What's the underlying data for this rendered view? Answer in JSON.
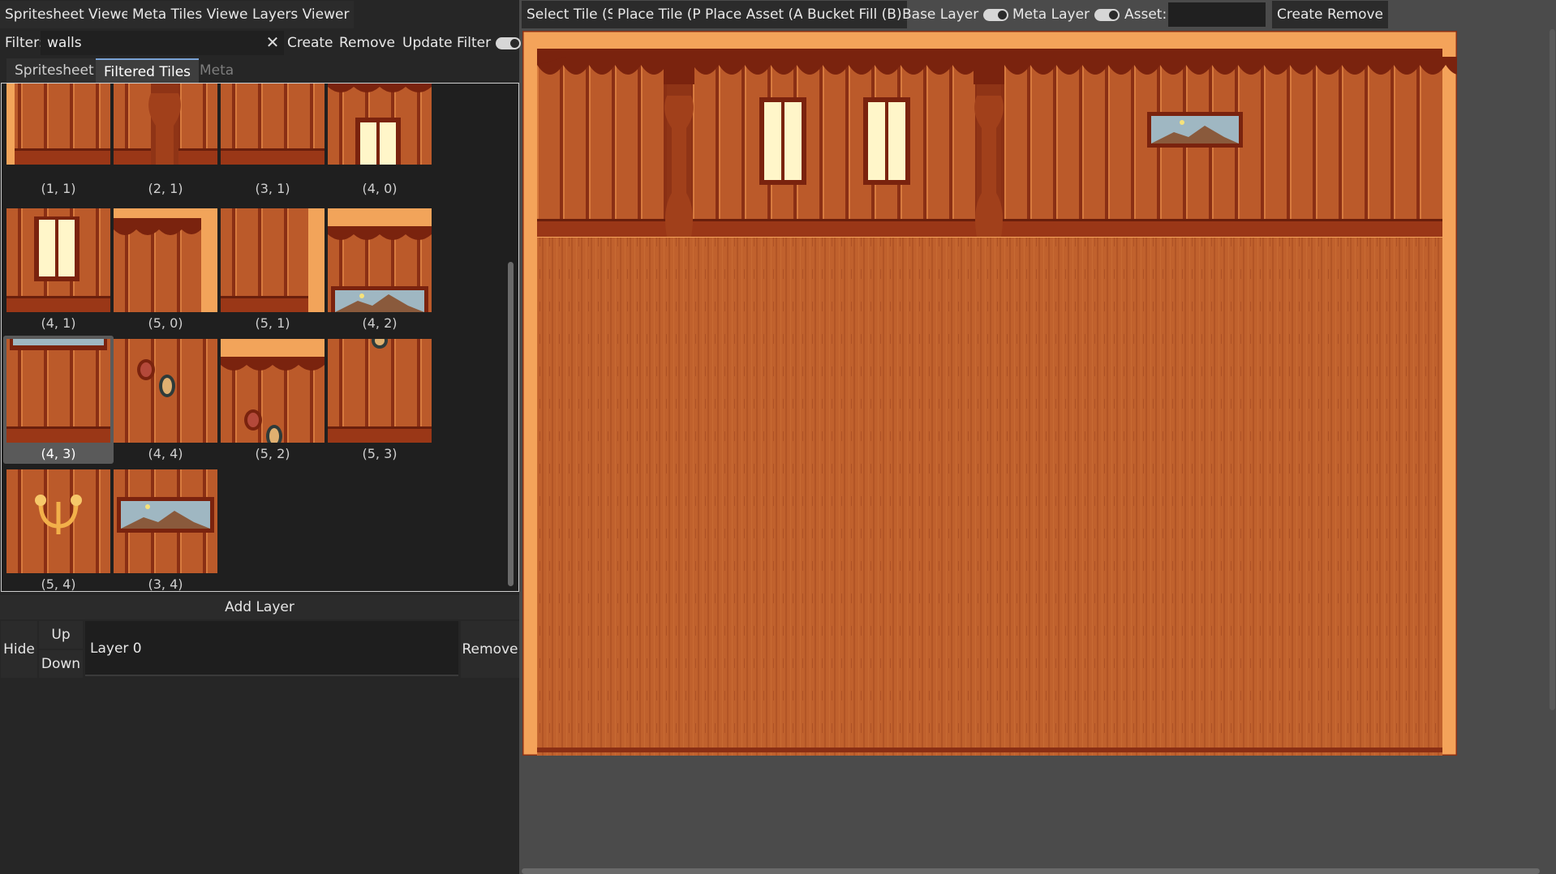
{
  "viewer_tabs": [
    "Spritesheet Viewer",
    "Meta Tiles Viewer",
    "Layers Viewer"
  ],
  "filter": {
    "label": "Filter:",
    "value": "walls",
    "clear_icon": "close-icon",
    "create_label": "Create",
    "remove_label": "Remove",
    "update_label": "Update Filter"
  },
  "sub_tabs": [
    "Spritesheet",
    "Filtered Tiles",
    "Meta"
  ],
  "active_sub_tab": "Filtered Tiles",
  "tiles": [
    {
      "label": "(1, 1)",
      "kind": "wall-base-left"
    },
    {
      "label": "(2, 1)",
      "kind": "pillar"
    },
    {
      "label": "(3, 1)",
      "kind": "wall-base"
    },
    {
      "label": "(4, 0)",
      "kind": "curtain-window-bottom"
    },
    {
      "label": "(4, 1)",
      "kind": "window"
    },
    {
      "label": "(5, 0)",
      "kind": "corner-top-right"
    },
    {
      "label": "(5, 1)",
      "kind": "edge-right"
    },
    {
      "label": "(4, 2)",
      "kind": "curtain-painting"
    },
    {
      "label": "(4, 3)",
      "kind": "wall-selected",
      "selected": true
    },
    {
      "label": "(4, 4)",
      "kind": "plates"
    },
    {
      "label": "(5, 2)",
      "kind": "curtain-plates"
    },
    {
      "label": "(5, 3)",
      "kind": "wall-hook"
    },
    {
      "label": "(5, 4)",
      "kind": "sconce"
    },
    {
      "label": "(3, 4)",
      "kind": "painting"
    }
  ],
  "layers": {
    "add_label": "Add Layer",
    "hide_label": "Hide",
    "up_label": "Up",
    "down_label": "Down",
    "remove_label": "Remove",
    "items": [
      {
        "name": "Layer 0"
      }
    ]
  },
  "toolbar": {
    "select_label": "Select Tile (S)",
    "place_tile_label": "Place Tile (P)",
    "place_asset_label": "Place Asset (A)",
    "bucket_label": "Bucket Fill (B)",
    "base_layer_label": "Base Layer",
    "meta_layer_label": "Meta Layer",
    "asset_label": "Asset:",
    "asset_value": "",
    "create_label": "Create",
    "remove_label": "Remove"
  },
  "colors": {
    "wood": "#b8572a",
    "wood_dark": "#8a2f14",
    "trim_light": "#f2a45a",
    "floor": "#c0612d",
    "panel_bg": "#262626"
  }
}
